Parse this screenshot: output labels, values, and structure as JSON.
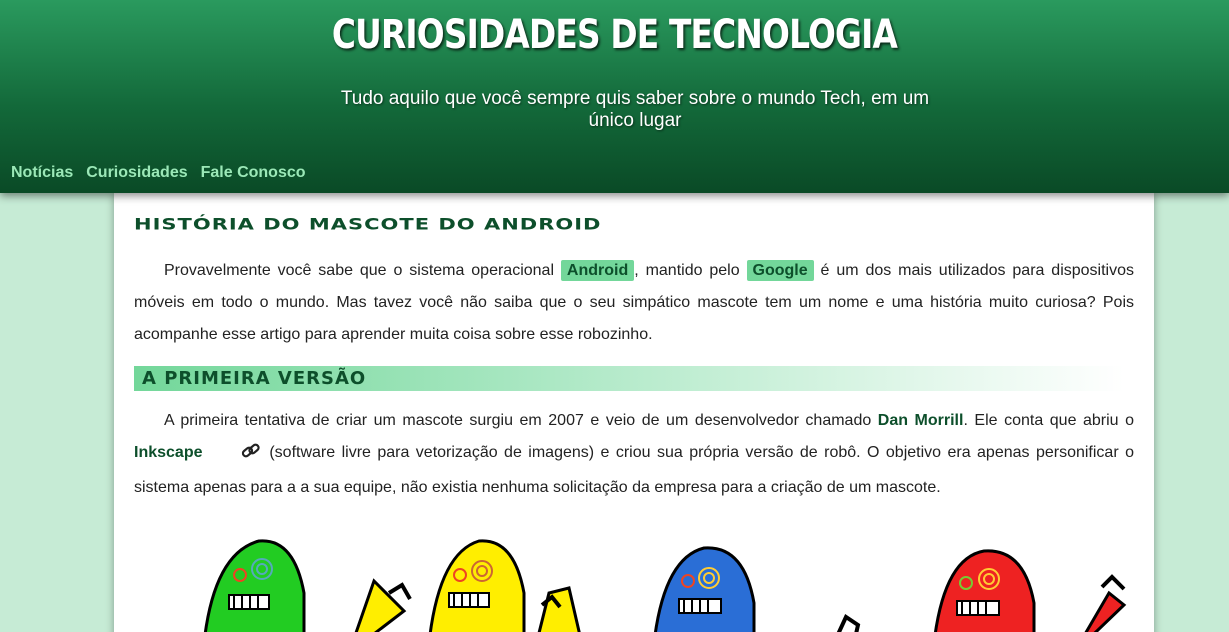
{
  "header": {
    "title": "CURIOSIDADES DE TECNOLOGIA",
    "subtitle": "Tudo aquilo que você sempre quis saber sobre o mundo Tech, em um único lugar"
  },
  "nav": {
    "items": [
      {
        "label": "Notícias"
      },
      {
        "label": "Curiosidades"
      },
      {
        "label": "Fale Conosco"
      }
    ]
  },
  "article": {
    "title": "História do Mascote do Android",
    "intro": {
      "t1": "Provavelmente você sabe que o sistema operacional ",
      "tag1": "Android",
      "t2": ", mantido pelo ",
      "tag2": "Google",
      "t3": " é um dos mais utilizados para dispositivos móveis em todo o mundo. Mas tavez você não saiba que o seu simpático mascote tem um nome e uma história muito curiosa? Pois acompanhe esse artigo para aprender muita coisa sobre esse robozinho."
    },
    "section1": {
      "title": "A Primeira Versão",
      "t1": "A primeira tentativa de criar um mascote surgiu em 2007 e veio de um desenvolvedor chamado ",
      "name": "Dan Morrill",
      "t2": ". Ele conta que abriu o ",
      "software": "Inkscape",
      "t3": " (software livre para vetorização de imagens) e criou sua própria versão de robô. O objetivo era apenas personificar o sistema apenas para a a sua equipe, não existia nenhuma solicitação da empresa para a criação de um mascote."
    },
    "illustration": {
      "icon": "robot-mascots-illustration",
      "colors": [
        "#22cc22",
        "#ffee00",
        "#2a6ed6",
        "#ee2222"
      ]
    }
  },
  "colors": {
    "header_dark": "#0a4a26",
    "accent": "#73d79a",
    "text_dark_green": "#0d4f2b",
    "page_bg": "#c6ebd5"
  }
}
